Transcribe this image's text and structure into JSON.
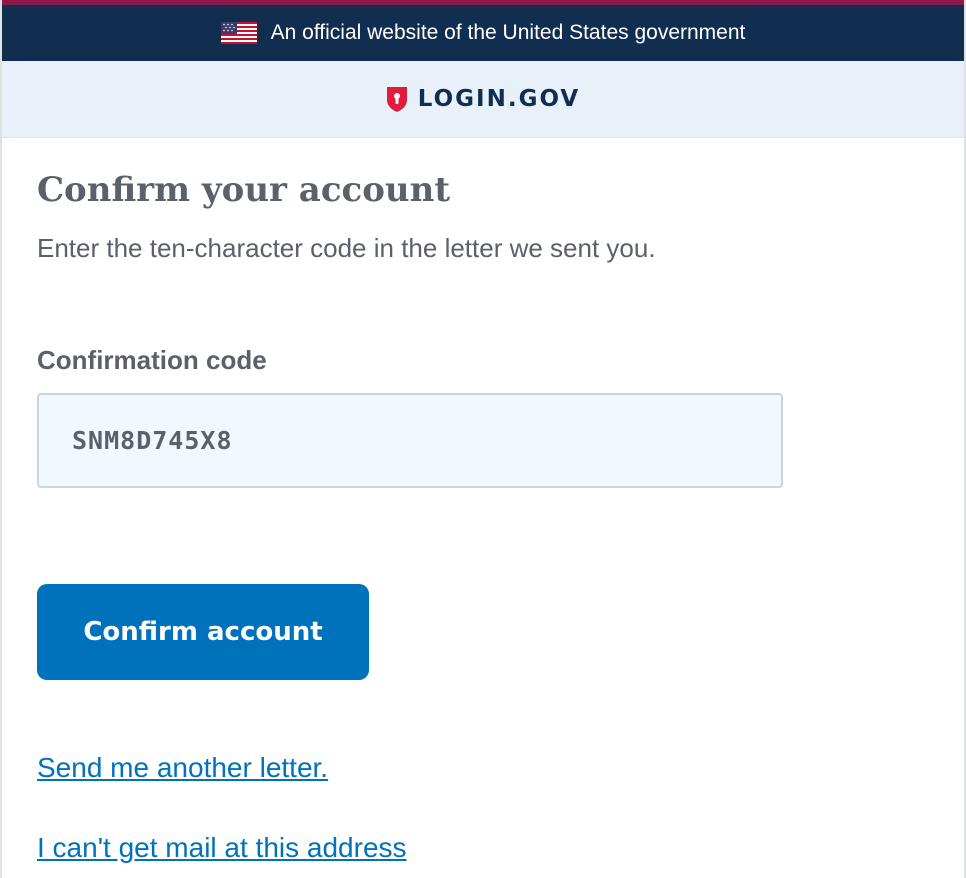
{
  "gov_banner": {
    "text": "An official website of the United States government",
    "flag_icon": "us-flag-icon"
  },
  "header": {
    "logo_text": "LOGIN.GOV",
    "logo_icon": "shield-lock-icon"
  },
  "main": {
    "title": "Confirm your account",
    "subtitle": "Enter the ten-character code in the letter we sent you.",
    "code_label": "Confirmation code",
    "code_value": "SNM8D745X8",
    "confirm_button_label": "Confirm account",
    "send_letter_link": "Send me another letter.",
    "cant_get_mail_link": "I can't get mail at this address"
  },
  "colors": {
    "accent_stripe": "#8b1a4a",
    "banner_bg": "#112e51",
    "header_bg": "#e8f1f9",
    "primary": "#0071bb",
    "text": "#5b616b",
    "logo_red": "#e21c3d"
  }
}
